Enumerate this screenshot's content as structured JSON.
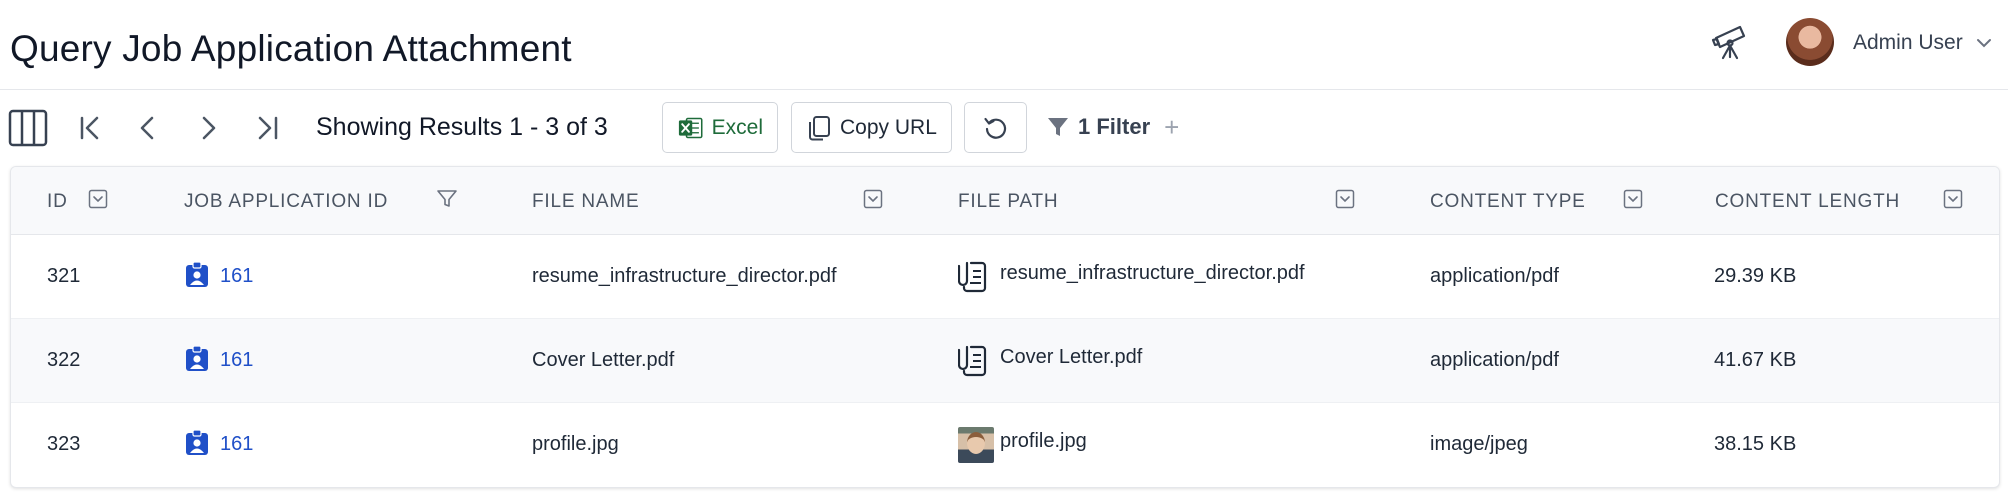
{
  "header": {
    "title": "Query Job Application Attachment",
    "user_name": "Admin User"
  },
  "toolbar": {
    "results_text": "Showing Results 1 - 3 of 3",
    "excel_label": "Excel",
    "copy_url_label": "Copy URL",
    "filter_label": "1 Filter",
    "filter_add": "+"
  },
  "table": {
    "columns": [
      "ID",
      "JOB APPLICATION ID",
      "FILE NAME",
      "FILE PATH",
      "CONTENT TYPE",
      "CONTENT LENGTH"
    ],
    "rows": [
      {
        "id": "321",
        "job_application_id": "161",
        "file_name": "resume_infrastructure_director.pdf",
        "file_path": "resume_infrastructure_director.pdf",
        "file_path_icon": "paperclip-document-icon",
        "content_type": "application/pdf",
        "content_length": "29.39 KB"
      },
      {
        "id": "322",
        "job_application_id": "161",
        "file_name": "Cover Letter.pdf",
        "file_path": "Cover Letter.pdf",
        "file_path_icon": "paperclip-document-icon",
        "content_type": "application/pdf",
        "content_length": "41.67 KB"
      },
      {
        "id": "323",
        "job_application_id": "161",
        "file_name": "profile.jpg",
        "file_path": "profile.jpg",
        "file_path_icon": "image-thumbnail",
        "content_type": "image/jpeg",
        "content_length": "38.15 KB"
      }
    ]
  },
  "colors": {
    "link": "#2050c8",
    "excel_green": "#1e6b3a",
    "header_bg": "#f8f9fb"
  }
}
